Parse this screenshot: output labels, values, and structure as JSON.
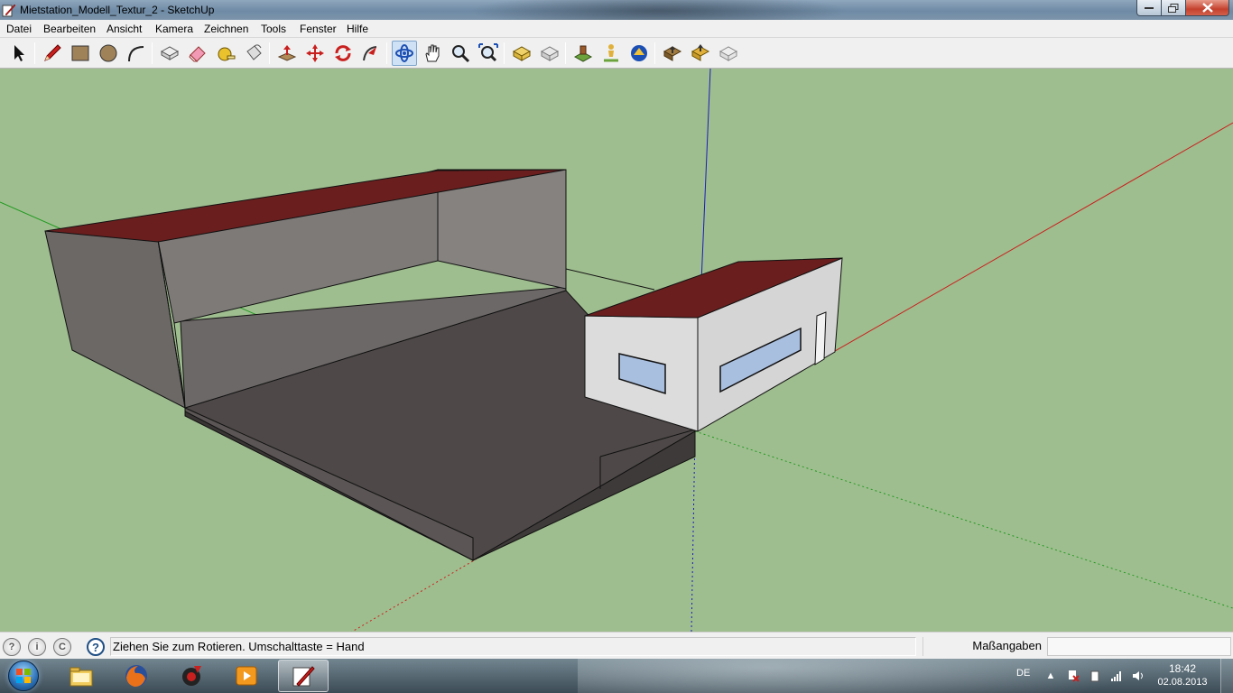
{
  "window": {
    "title": "Mietstation_Modell_Textur_2 - SketchUp"
  },
  "menu": [
    "Datei",
    "Bearbeiten",
    "Ansicht",
    "Kamera",
    "Zeichnen",
    "Tools",
    "Fenster",
    "Hilfe"
  ],
  "toolbar": {
    "tools": [
      "select-tool-icon",
      "pencil-line-tool-icon",
      "rectangle-tool-icon",
      "circle-tool-icon",
      "arc-tool-icon",
      "make-component-icon",
      "eraser-tool-icon",
      "tape-measure-icon",
      "paint-bucket-icon",
      "push-pull-icon",
      "move-tool-icon",
      "rotate-tool-icon",
      "follow-me-icon",
      "orbit-tool-icon",
      "pan-tool-icon",
      "zoom-tool-icon",
      "zoom-extents-icon",
      "get-models-icon",
      "share-model-icon",
      "add-location-icon",
      "position-camera-icon",
      "look-around-icon",
      "walk-icon",
      "section-plane-icon",
      "get-photo-texture-icon",
      "preview-in-google-earth-icon"
    ],
    "active_tool": "orbit-tool-icon"
  },
  "status": {
    "hint": "Ziehen Sie zum Rotieren.  Umschalttaste = Hand",
    "vcb_label": "Maßangaben",
    "vcb_value": ""
  },
  "colors": {
    "sky_ground": "#9fbe8f",
    "roof": "#6b1e1e",
    "red_axis": "#c8201e",
    "green_axis": "#1f9a1f",
    "blue_axis": "#1c1cb8"
  },
  "taskbar": {
    "apps": [
      "windows-explorer-icon",
      "firefox-icon",
      "screen-recorder-icon",
      "media-player-icon",
      "sketchup-icon"
    ],
    "active_app": "sketchup-icon",
    "language": "DE",
    "time": "18:42",
    "date": "02.08.2013"
  }
}
